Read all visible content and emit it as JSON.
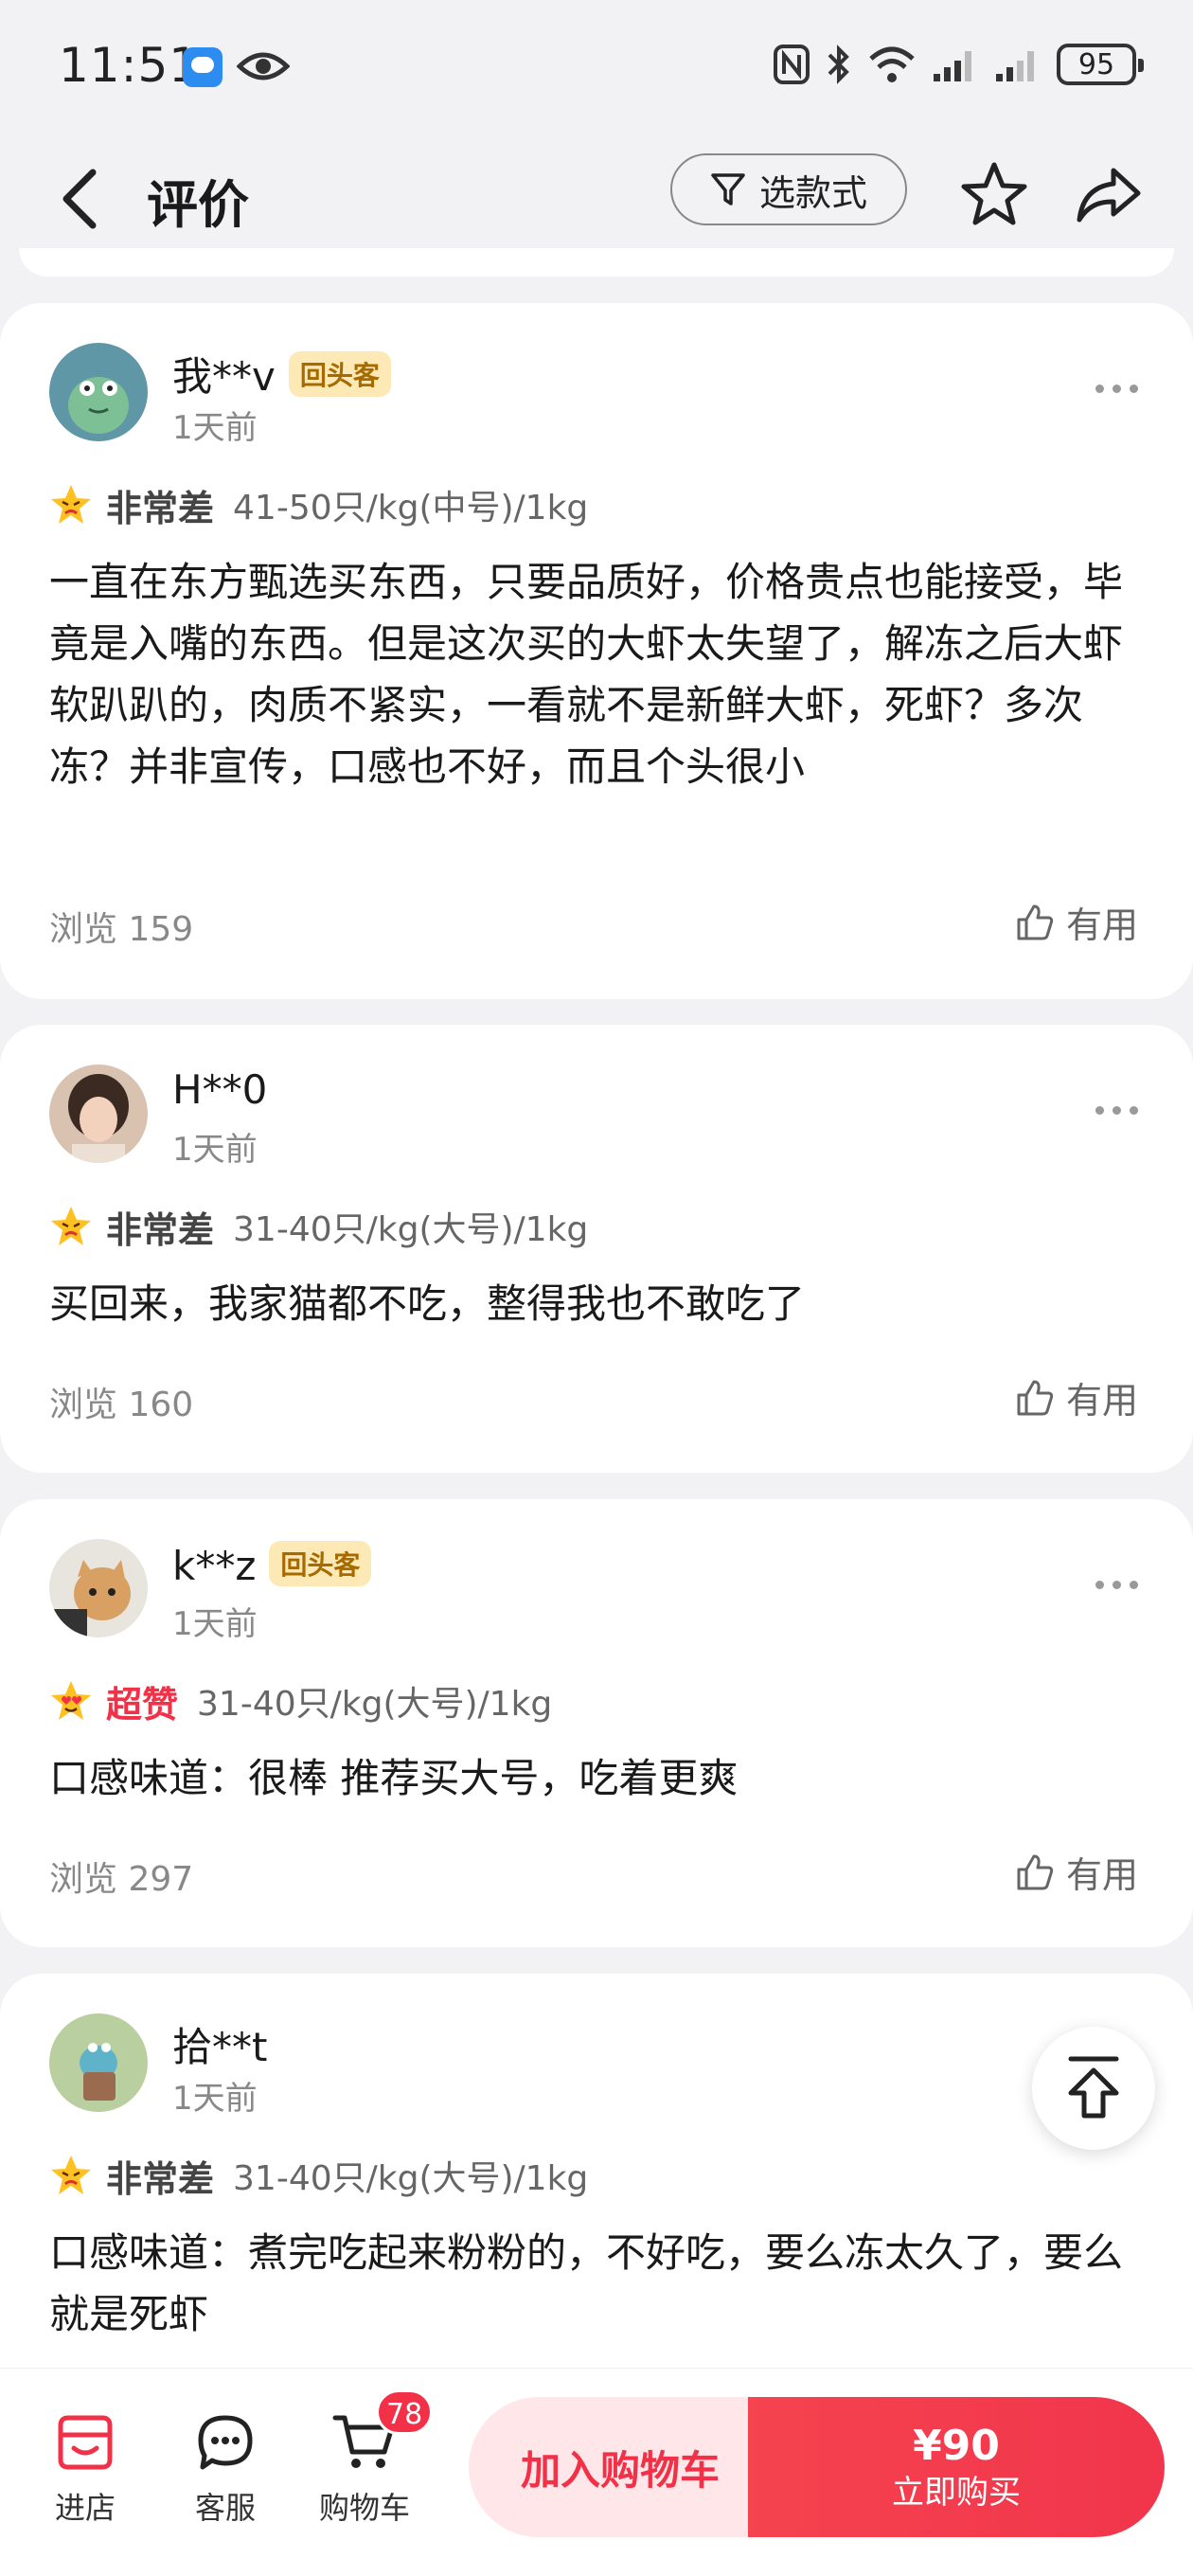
{
  "status_bar": {
    "time": "11:51",
    "battery": "95"
  },
  "header": {
    "title": "评价",
    "filter_label": "选款式"
  },
  "reviews": [
    {
      "user": "我**v",
      "badge": "回头客",
      "time": "1天前",
      "rating": "非常差",
      "spec": "41-50只/kg(中号)/1kg",
      "text": "一直在东方甄选买东西，只要品质好，价格贵点也能接受，毕竟是入嘴的东西。但是这次买的大虾太失望了，解冻之后大虾软趴趴的，肉质不紧实，一看就不是新鲜大虾，死虾？多次冻？并非宣传，口感也不好，而且个头很小",
      "views": "浏览 159",
      "helpful": "有用"
    },
    {
      "user": "H**0",
      "badge": "",
      "time": "1天前",
      "rating": "非常差",
      "spec": "31-40只/kg(大号)/1kg",
      "text": "买回来，我家猫都不吃，整得我也不敢吃了",
      "views": "浏览 160",
      "helpful": "有用"
    },
    {
      "user": "k**z",
      "badge": "回头客",
      "time": "1天前",
      "rating": "超赞",
      "spec": "31-40只/kg(大号)/1kg",
      "text": "口感味道：很棒 推荐买大号，吃着更爽",
      "views": "浏览 297",
      "helpful": "有用"
    },
    {
      "user": "拾**t",
      "badge": "",
      "time": "1天前",
      "rating": "非常差",
      "spec": "31-40只/kg(大号)/1kg",
      "text": "口感味道：煮完吃起来粉粉的，不好吃，要么冻太久了，要么就是死虾",
      "views": "",
      "helpful": ""
    }
  ],
  "bottom_bar": {
    "store": "进店",
    "service": "客服",
    "cart": "购物车",
    "cart_count": "78",
    "add_to_cart": "加入购物车",
    "price": "¥90",
    "buy_now": "立即购买"
  },
  "colors": {
    "accent": "#f23047",
    "badge_bg": "#fde9b5",
    "page_bg": "#f2f2f5"
  }
}
